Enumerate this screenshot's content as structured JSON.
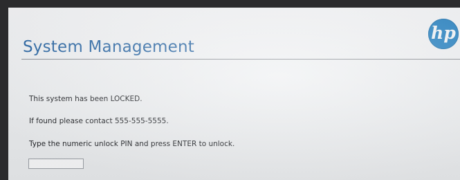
{
  "header": {
    "title": "System Management",
    "logo_text": "hp",
    "logo_icon": "hp-logo-icon",
    "title_color": "#2f6aa6",
    "logo_color": "#2e86c4"
  },
  "messages": {
    "locked": "This system has been LOCKED.",
    "contact": "If found please contact 555-555-5555.",
    "prompt": "Type the numeric unlock PIN and press ENTER to unlock."
  },
  "pin_input": {
    "value": "",
    "placeholder": ""
  }
}
